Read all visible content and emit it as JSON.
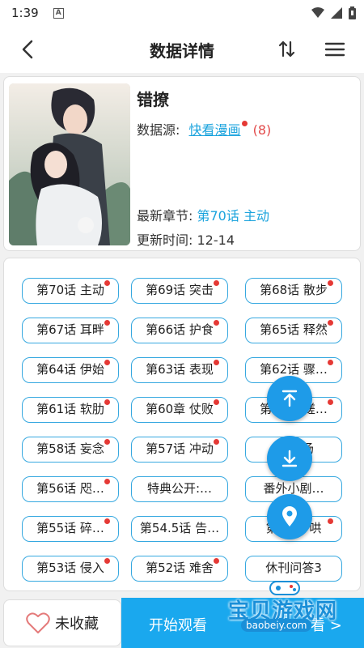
{
  "status_bar": {
    "time": "1:39",
    "notification_badge": "A"
  },
  "header": {
    "title": "数据详情"
  },
  "manga": {
    "title": "错撩",
    "source_label": "数据源:",
    "source_name": "快看漫画",
    "source_count": "(8)",
    "latest_label": "最新章节:",
    "latest_chapter": "第70话 主动",
    "update_label": "更新时间:",
    "update_time": "12-14"
  },
  "chapters": [
    {
      "label": "第70话 主动",
      "new": true
    },
    {
      "label": "第69话 突击",
      "new": true
    },
    {
      "label": "第68话 散步",
      "new": true
    },
    {
      "label": "第67话 耳畔",
      "new": true
    },
    {
      "label": "第66话 护食",
      "new": true
    },
    {
      "label": "第65话 释然",
      "new": true
    },
    {
      "label": "第64话 伊始",
      "new": true
    },
    {
      "label": "第63话 表现",
      "new": true
    },
    {
      "label": "第62话 骤…",
      "new": true
    },
    {
      "label": "第61话 软肋",
      "new": true
    },
    {
      "label": "第60章 仗败",
      "new": true
    },
    {
      "label": "第59话 磋…",
      "new": true
    },
    {
      "label": "第58话 妄念",
      "new": true
    },
    {
      "label": "第57话 冲动",
      "new": true
    },
    {
      "label": "番外 扬",
      "new": false
    },
    {
      "label": "第56话 咫…",
      "new": true
    },
    {
      "label": "特典公开:…",
      "new": false
    },
    {
      "label": "番外小剧…",
      "new": false
    },
    {
      "label": "第55话 碎…",
      "new": true
    },
    {
      "label": "第54.5话 告…",
      "new": false
    },
    {
      "label": "第54话 哄",
      "new": true
    },
    {
      "label": "第53话 侵入",
      "new": true
    },
    {
      "label": "第52话 难舍",
      "new": true
    },
    {
      "label": "休刊问答3",
      "new": false
    }
  ],
  "bottom": {
    "favorite_label": "未收藏",
    "start_label": "开始观看",
    "start_arrow": "看 >"
  },
  "watermark": {
    "brand": "宝贝游戏网",
    "url": "baobeiy.com"
  },
  "colors": {
    "accent": "#1aa8ee",
    "chip_border": "#36a8e0",
    "new_dot": "#e53935",
    "count": "#e24b4b"
  }
}
